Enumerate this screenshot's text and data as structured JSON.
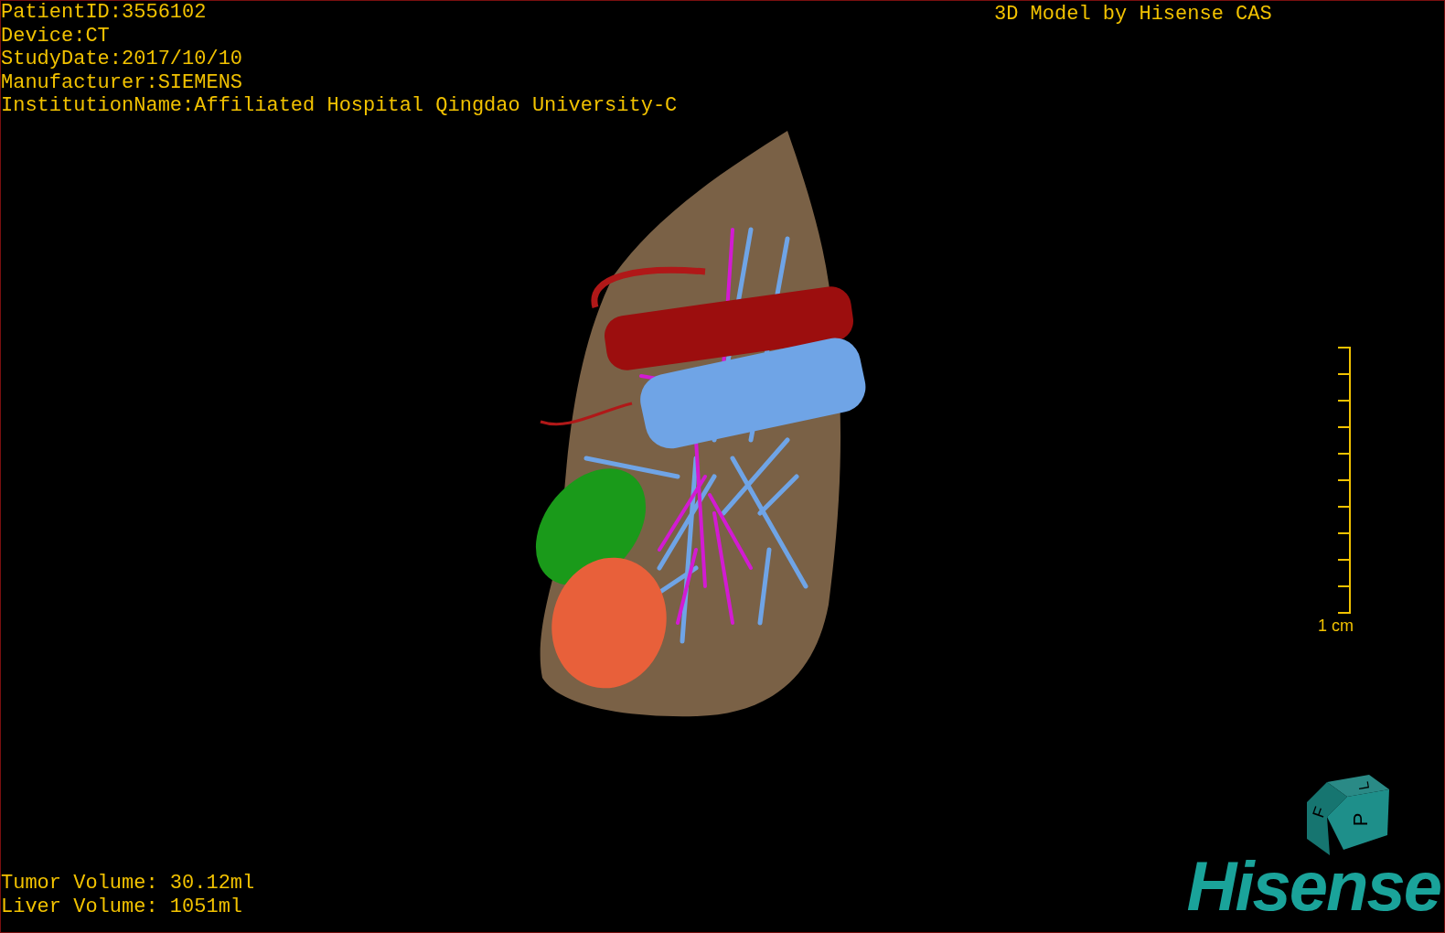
{
  "patient_info": [
    "PatientID:3556102",
    "Device:CT",
    "StudyDate:2017/10/10",
    "Manufacturer:SIEMENS",
    "InstitutionName:Affiliated Hospital Qingdao University-C"
  ],
  "caption": "3D Model by Hisense CAS",
  "scale_bar": {
    "label": "1 cm"
  },
  "orientation_cube": {
    "faces": [
      "F",
      "L",
      "P"
    ]
  },
  "volumes": [
    "Tumor Volume: 30.12ml",
    "Liver Volume: 1051ml"
  ],
  "logo": "Hisense"
}
